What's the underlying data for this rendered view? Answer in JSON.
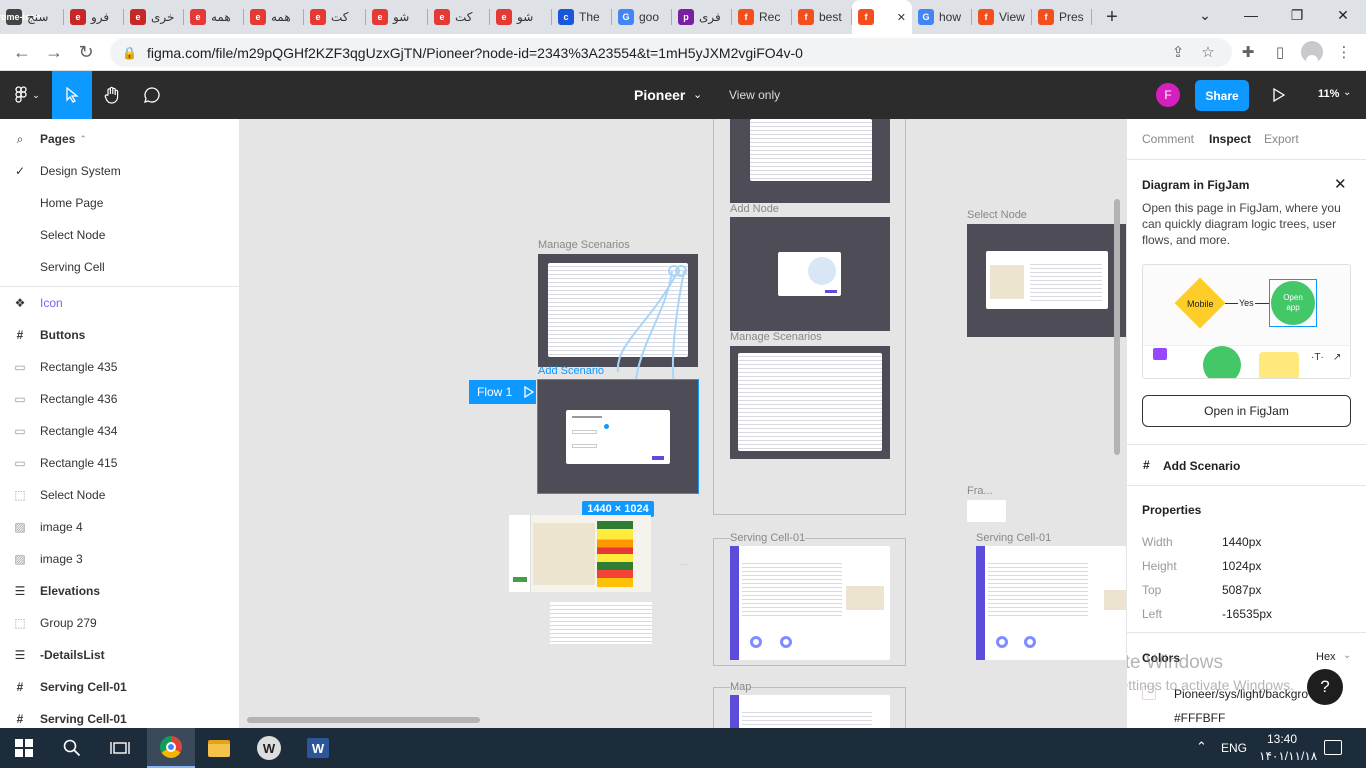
{
  "browser": {
    "tabs": [
      {
        "label": "سنج",
        "fav": "chrome-icon",
        "color": "#444",
        "w": 64
      },
      {
        "label": "فرو",
        "fav": "e",
        "color": "#c62828",
        "w": 60
      },
      {
        "label": "خری",
        "fav": "e",
        "color": "#c62828",
        "w": 60
      },
      {
        "label": "همه",
        "fav": "e",
        "color": "#e53935",
        "w": 60
      },
      {
        "label": "همه",
        "fav": "e",
        "color": "#e53935",
        "w": 60
      },
      {
        "label": "کت",
        "fav": "e",
        "color": "#e53935",
        "w": 62
      },
      {
        "label": "شو",
        "fav": "e",
        "color": "#e53935",
        "w": 62
      },
      {
        "label": "کت",
        "fav": "e",
        "color": "#e53935",
        "w": 62
      },
      {
        "label": "شو",
        "fav": "e",
        "color": "#e53935",
        "w": 62
      },
      {
        "label": "The",
        "fav": "c",
        "color": "#1a56db",
        "w": 60
      },
      {
        "label": "goo",
        "fav": "G",
        "color": "#4285f4",
        "w": 60
      },
      {
        "label": "فری",
        "fav": "p",
        "color": "#7b1fa2",
        "w": 60
      },
      {
        "label": "Rec",
        "fav": "f",
        "color": "#f24e1e",
        "w": 60
      },
      {
        "label": "best",
        "fav": "f",
        "color": "#f24e1e",
        "w": 60
      },
      {
        "label": "",
        "fav": "f",
        "color": "#f24e1e",
        "w": 60,
        "active": true
      },
      {
        "label": "how",
        "fav": "G",
        "color": "#4285f4",
        "w": 60
      },
      {
        "label": "View",
        "fav": "f",
        "color": "#f24e1e",
        "w": 60
      },
      {
        "label": "Pres",
        "fav": "f",
        "color": "#f24e1e",
        "w": 60
      }
    ],
    "url": "figma.com/file/m29pQGHf2KZF3qgUzxGjTN/Pioneer?node-id=2343%3A23554&t=1mH5yJXM2vgiFO4v-0"
  },
  "figma": {
    "file_name": "Pioneer",
    "view_mode": "View only",
    "avatar": "F",
    "share": "Share",
    "zoom": "11%"
  },
  "left_panel": {
    "pages_label": "Pages",
    "pages": [
      {
        "label": "Design System",
        "checked": true
      },
      {
        "label": "Home Page"
      },
      {
        "label": "Select Node"
      },
      {
        "label": "Serving Cell"
      }
    ],
    "layers": [
      {
        "label": "Icon",
        "icon": "component-icon",
        "style": "purple"
      },
      {
        "label": "Buttons",
        "icon": "frame-icon",
        "style": "bold"
      },
      {
        "label": "Rectangle 435",
        "icon": "rectangle-icon"
      },
      {
        "label": "Rectangle 436",
        "icon": "rectangle-icon"
      },
      {
        "label": "Rectangle 434",
        "icon": "rectangle-icon"
      },
      {
        "label": "Rectangle 415",
        "icon": "rectangle-icon"
      },
      {
        "label": "Select Node",
        "icon": "dashed-rect-icon"
      },
      {
        "label": "image 4",
        "icon": "image-icon"
      },
      {
        "label": "image 3",
        "icon": "image-icon"
      },
      {
        "label": "Elevations",
        "icon": "lines-icon",
        "style": "bold"
      },
      {
        "label": "Group 279",
        "icon": "dashed-rect-icon"
      },
      {
        "label": "-DetailsList",
        "icon": "lines-icon",
        "style": "bold"
      },
      {
        "label": "Serving Cell-01",
        "icon": "frame-icon",
        "style": "bold"
      },
      {
        "label": "Serving Cell-01",
        "icon": "frame-icon",
        "style": "bold"
      }
    ]
  },
  "canvas": {
    "labels": {
      "manage1": "Manage Scenarios",
      "add_scenario": "Add Scenario",
      "add_node": "Add Node",
      "manage2": "Manage Scenarios",
      "select_node": "Select Node",
      "fra": "Fra...",
      "serving1": "Serving Cell-01",
      "serving2": "Serving Cell-01",
      "map": "Map"
    },
    "flow_label": "Flow 1",
    "dimension_badge": "1440 × 1024"
  },
  "right_panel": {
    "tabs": [
      "Comment",
      "Inspect",
      "Export"
    ],
    "active_tab": "Inspect",
    "diagram": {
      "title": "Diagram in FigJam",
      "description": "Open this page in FigJam, where you can quickly diagram logic trees, user flows, and more.",
      "node_mobile": "Mobile",
      "edge_yes": "Yes",
      "node_open": "Open app",
      "button": "Open in FigJam"
    },
    "selection": "Add Scenario",
    "properties_title": "Properties",
    "properties": [
      {
        "key": "Width",
        "value": "1440px"
      },
      {
        "key": "Height",
        "value": "1024px"
      },
      {
        "key": "Top",
        "value": "5087px"
      },
      {
        "key": "Left",
        "value": "-16535px"
      }
    ],
    "colors_title": "Colors",
    "colors_format": "Hex",
    "color_name": "Pioneer/sys/light/backgro",
    "color_hex": "#FFFBFF",
    "watermark_title": "Activate Windows",
    "watermark_sub": "Go to Settings to activate Windows."
  },
  "taskbar": {
    "lang": "ENG",
    "time": "13:40",
    "date": "۱۴۰۱/۱۱/۱۸"
  }
}
